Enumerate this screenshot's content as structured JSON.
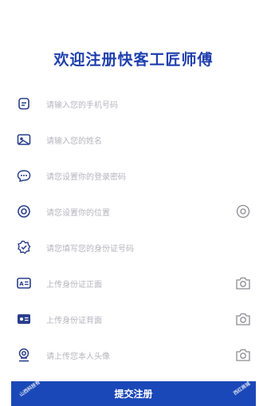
{
  "title": "欢迎注册快客工匠师傅",
  "fields": [
    {
      "icon": "phone-icon",
      "placeholder": "请输入您的手机号码"
    },
    {
      "icon": "name-card-icon",
      "placeholder": "请输入您的姓名"
    },
    {
      "icon": "password-icon",
      "placeholder": "请您设置你的登录密码"
    },
    {
      "icon": "location-icon",
      "placeholder": "请您设置你的位置",
      "action_icon": "location-pin-icon"
    },
    {
      "icon": "id-badge-icon",
      "placeholder": "请您填写您的身份证号码"
    },
    {
      "icon": "id-front-icon",
      "placeholder": "上传身份证正面",
      "action_icon": "camera-icon"
    },
    {
      "icon": "id-back-icon",
      "placeholder": "上传身份证背面",
      "action_icon": "camera-icon"
    },
    {
      "icon": "avatar-icon",
      "placeholder": "请上传您本人头像",
      "action_icon": "camera-icon"
    }
  ],
  "submit_label": "提交注册",
  "watermark": {
    "left": "山西科技有",
    "right": "西红商城"
  },
  "colors": {
    "accent": "#1b48b8",
    "title": "#1f3fae",
    "icon": "#2a3e8c",
    "placeholder": "#b5b5bd"
  }
}
